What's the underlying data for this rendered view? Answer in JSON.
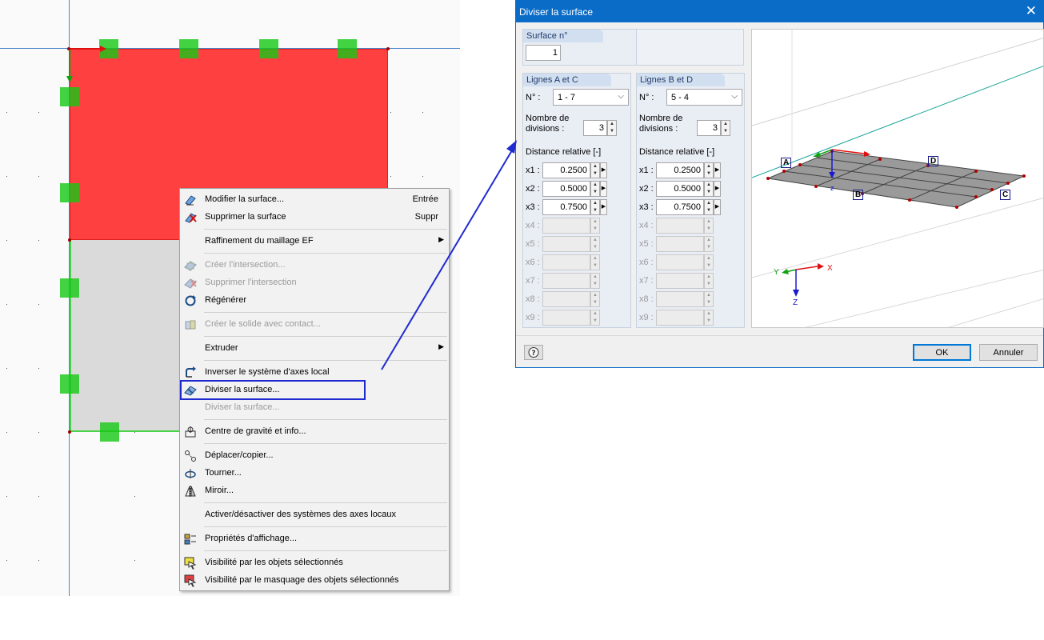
{
  "context_menu": {
    "items": [
      {
        "label": "Modifier la surface...",
        "shortcut": "Entrée"
      },
      {
        "label": "Supprimer la surface",
        "shortcut": "Suppr"
      },
      {
        "label": "Raffinement du maillage EF"
      },
      {
        "label": "Créer l'intersection..."
      },
      {
        "label": "Supprimer l'intersection"
      },
      {
        "label": "Régénérer"
      },
      {
        "label": "Créer le solide avec contact..."
      },
      {
        "label": "Extruder"
      },
      {
        "label": "Inverser le système d'axes local"
      },
      {
        "label": "Diviser la surface..."
      },
      {
        "label": "Diviser la surface..."
      },
      {
        "label": "Centre de gravité et info..."
      },
      {
        "label": "Déplacer/copier..."
      },
      {
        "label": "Tourner..."
      },
      {
        "label": "Miroir..."
      },
      {
        "label": "Activer/désactiver des systèmes des axes locaux"
      },
      {
        "label": "Propriétés d'affichage..."
      },
      {
        "label": "Visibilité par les objets sélectionnés"
      },
      {
        "label": "Visibilité par le masquage des objets sélectionnés"
      }
    ],
    "highlighted_item": "Diviser la surface..."
  },
  "dialog": {
    "title": "Diviser la surface",
    "close_glyph": "✕",
    "surface_group": {
      "header": "Surface n°",
      "value": "1"
    },
    "lines_ac": {
      "header": "Lignes A et C",
      "no_label": "N° :",
      "no_value": "1 - 7",
      "divisions_label_1": "Nombre de",
      "divisions_label_2": "divisions :",
      "divisions_value": "3",
      "distance_label": "Distance relative [-]",
      "x_labels": [
        "x1 :",
        "x2 :",
        "x3 :",
        "x4 :",
        "x5 :",
        "x6 :",
        "x7 :",
        "x8 :",
        "x9 :"
      ],
      "x_values": [
        "0.2500",
        "0.5000",
        "0.7500",
        "",
        "",
        "",
        "",
        "",
        ""
      ]
    },
    "lines_bd": {
      "header": "Lignes B et D",
      "no_label": "N° :",
      "no_value": "5 - 4",
      "divisions_label_1": "Nombre de",
      "divisions_label_2": "divisions :",
      "divisions_value": "3",
      "distance_label": "Distance relative [-]",
      "x_labels": [
        "x1 :",
        "x2 :",
        "x3 :",
        "x4 :",
        "x5 :",
        "x6 :",
        "x7 :",
        "x8 :",
        "x9 :"
      ],
      "x_values": [
        "0.2500",
        "0.5000",
        "0.7500",
        "",
        "",
        "",
        "",
        "",
        ""
      ]
    },
    "preview": {
      "labels": [
        "A",
        "B",
        "C",
        "D"
      ],
      "axis_x": "X",
      "axis_y": "Y",
      "axis_z": "Z",
      "local_x": "x",
      "local_z": "z"
    },
    "buttons": {
      "ok": "OK",
      "cancel": "Annuler"
    }
  },
  "colors": {
    "surface_red": "#ff4040",
    "surface_grey": "#dadada",
    "node_green": "#14c814",
    "highlight_blue": "#1f2ad0",
    "title_bar": "#0b6cc7"
  }
}
